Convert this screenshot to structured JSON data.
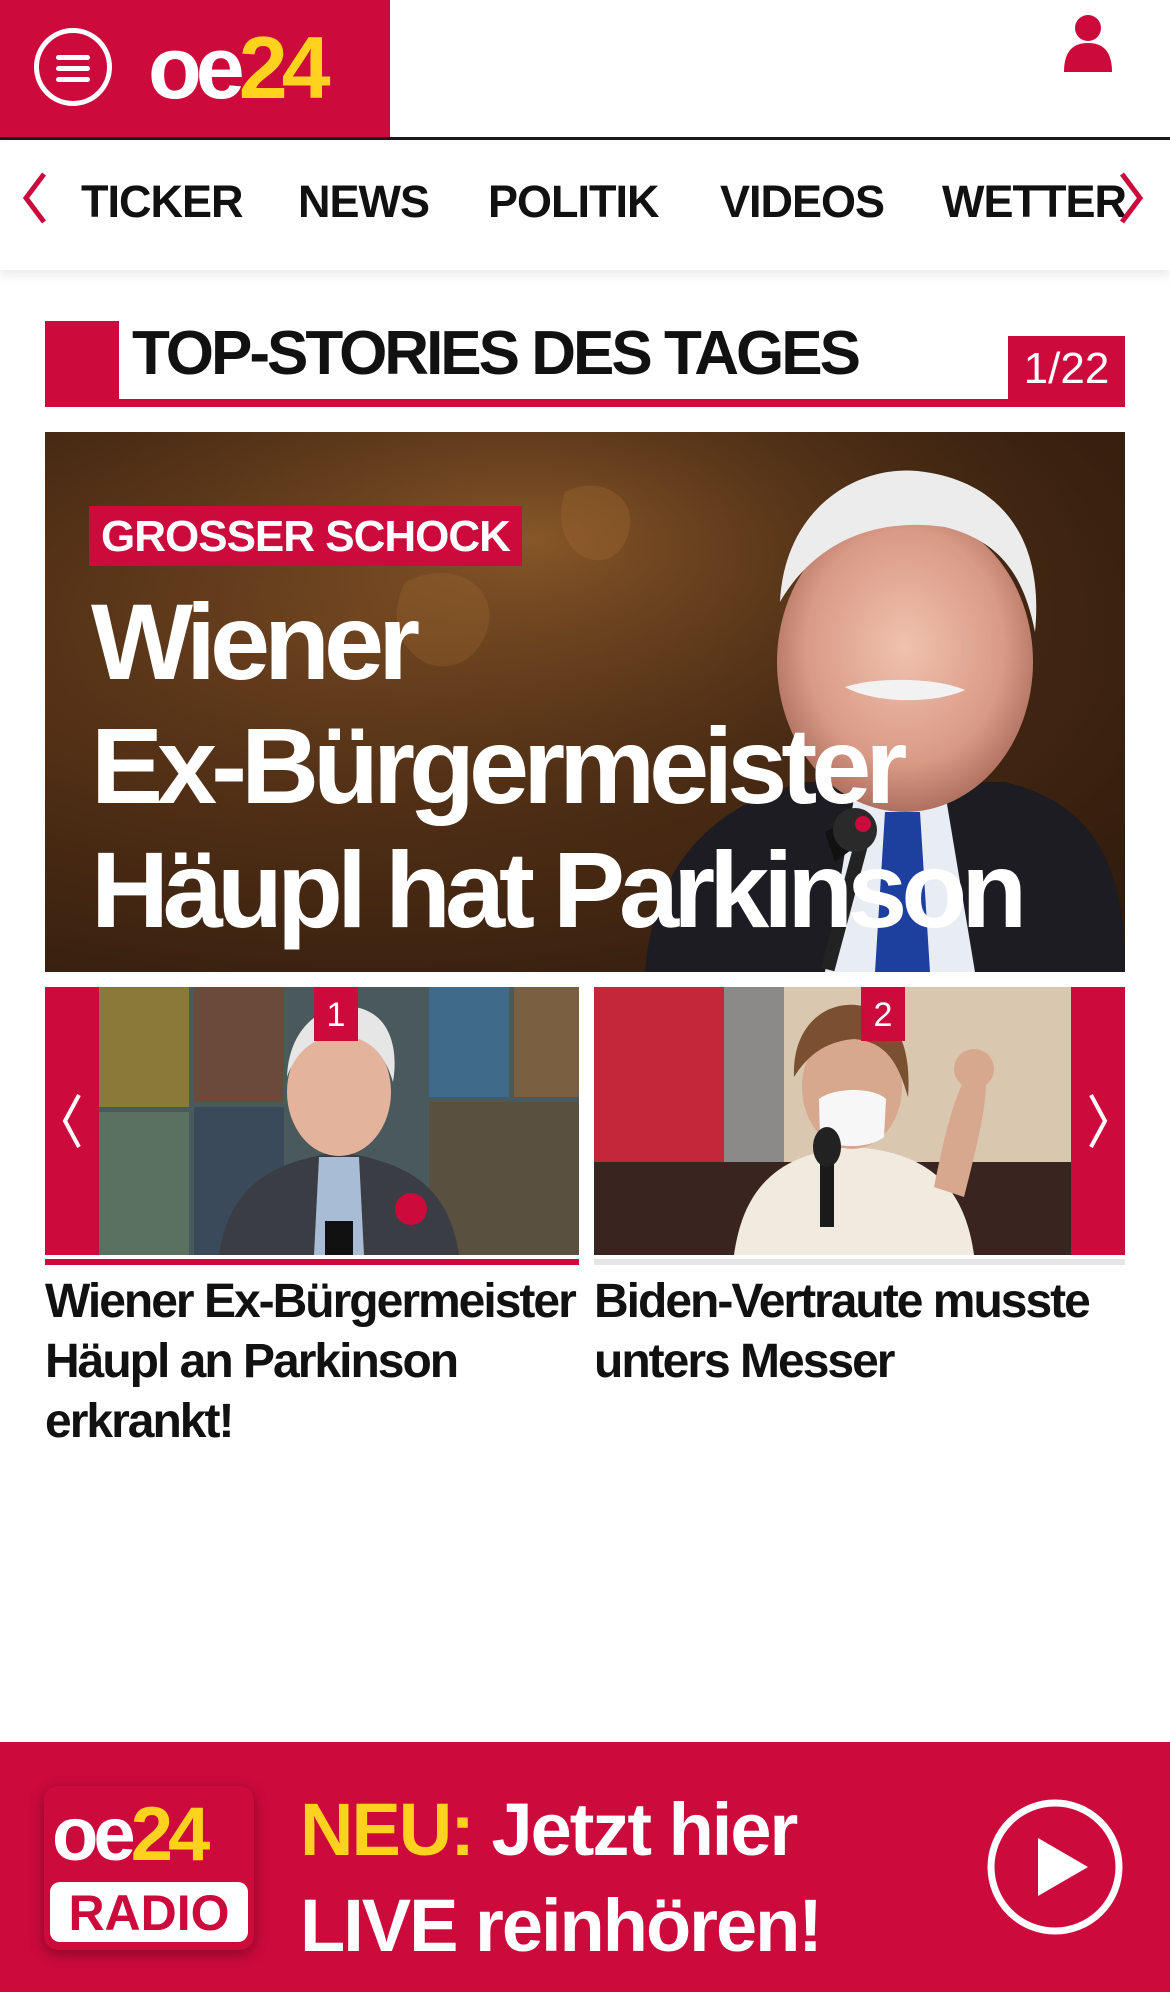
{
  "header": {
    "logo_oe": "oe",
    "logo_num": "24",
    "menu_icon": "hamburger-menu-icon",
    "user_icon": "user-icon"
  },
  "nav": {
    "items": [
      "TICKER",
      "NEWS",
      "POLITIK",
      "VIDEOS",
      "WETTER"
    ],
    "prev_icon": "chevron-left-icon",
    "next_icon": "chevron-right-icon"
  },
  "section": {
    "title": "TOP-STORIES DES TAGES",
    "counter": "1/22"
  },
  "hero": {
    "kicker": "GROSSER SCHOCK",
    "title_lines": [
      "Wiener",
      "Ex-Bürgermeister",
      "Häupl hat Parkinson"
    ]
  },
  "carousel": {
    "items": [
      {
        "num": "1",
        "title": "Wiener Ex-Bürgermeister Häupl an Parkinson erkrankt!"
      },
      {
        "num": "2",
        "title": "Biden-Vertraute musste unters Messer"
      }
    ]
  },
  "radio": {
    "logo_oe": "oe",
    "logo_num": "24",
    "logo_label": "RADIO",
    "line1_highlight": "NEU:",
    "line1_rest": " Jetzt hier",
    "line2": "LIVE reinhören!",
    "play_icon": "play-icon"
  },
  "colors": {
    "brand_red": "#cc0a3c",
    "accent_yellow": "#ffd21e"
  }
}
